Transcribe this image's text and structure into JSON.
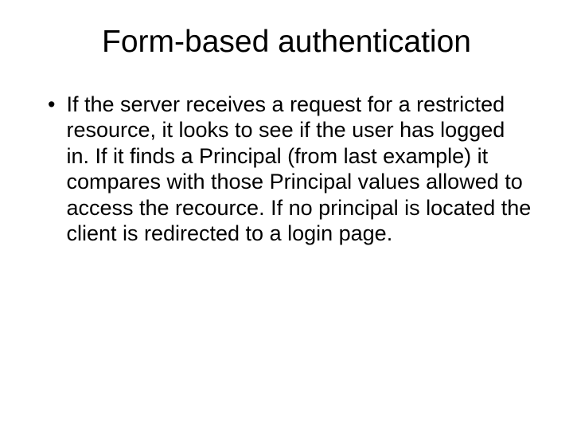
{
  "slide": {
    "title": "Form-based authentication",
    "bullet": {
      "marker": "•",
      "text": "If the server receives a request for a restricted resource, it looks to see if the user has logged in.  If it finds a Principal (from last example) it compares with those Principal values allowed to access the recource.  If no principal is located the client is redirected to a login page."
    }
  }
}
